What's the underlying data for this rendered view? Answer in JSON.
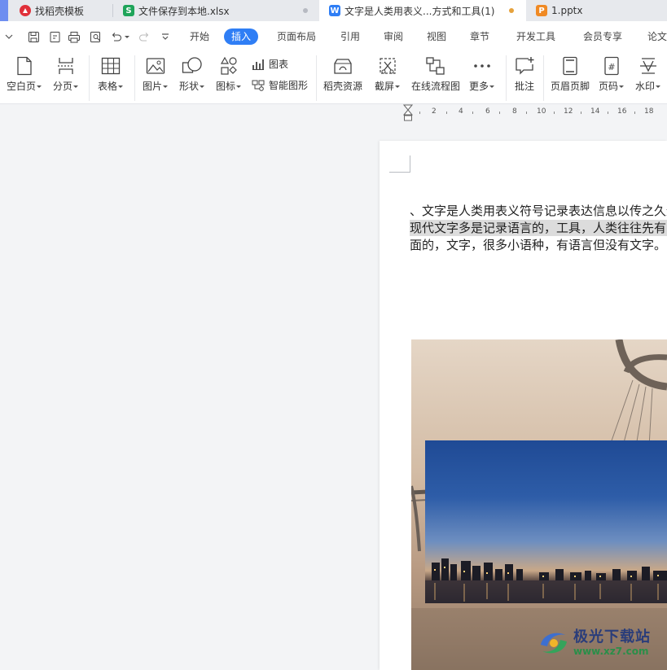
{
  "tabs": [
    {
      "label": "找稻壳模板",
      "icon": "docer-icon",
      "color": "#e0303a"
    },
    {
      "label": "文件保存到本地.xlsx",
      "icon": "spreadsheet-icon",
      "color": "#1fa45a"
    },
    {
      "label": "文字是人类用表义...方式和工具(1)",
      "icon": "writer-icon",
      "color": "#2f7ef5"
    },
    {
      "label": "1.pptx",
      "icon": "presentation-icon",
      "color": "#f08a24"
    }
  ],
  "icon_letters": {
    "docer": "",
    "spreadsheet": "S",
    "writer": "W",
    "presentation": "P"
  },
  "menu": {
    "items": [
      "开始",
      "插入",
      "页面布局",
      "引用",
      "审阅",
      "视图",
      "章节",
      "开发工具",
      "会员专享",
      "论文"
    ],
    "active": "插入"
  },
  "ribbon": {
    "blank_page": "空白页",
    "page_break": "分页",
    "table": "表格",
    "picture": "图片",
    "shape": "形状",
    "icon": "图标",
    "chart": "图表",
    "smart_art": "智能图形",
    "docer_resources": "稻壳资源",
    "screenshot": "截屏",
    "flowchart": "在线流程图",
    "more": "更多",
    "comment": "批注",
    "header_footer": "页眉页脚",
    "page_number": "页码",
    "watermark": "水印"
  },
  "ruler": {
    "labels": [
      "2",
      "4",
      "6",
      "8",
      "10",
      "12",
      "14",
      "16",
      "18"
    ]
  },
  "document": {
    "lines": [
      "、文字是人类用表义符号记录表达信息以传之久远",
      "现代文字多是记录语言的，工具，人类往往先有口头",
      "面的，文字，很多小语种，有语言但没有文字。"
    ]
  },
  "watermark": {
    "title": "极光下载站",
    "url": "www.xz7.com"
  }
}
